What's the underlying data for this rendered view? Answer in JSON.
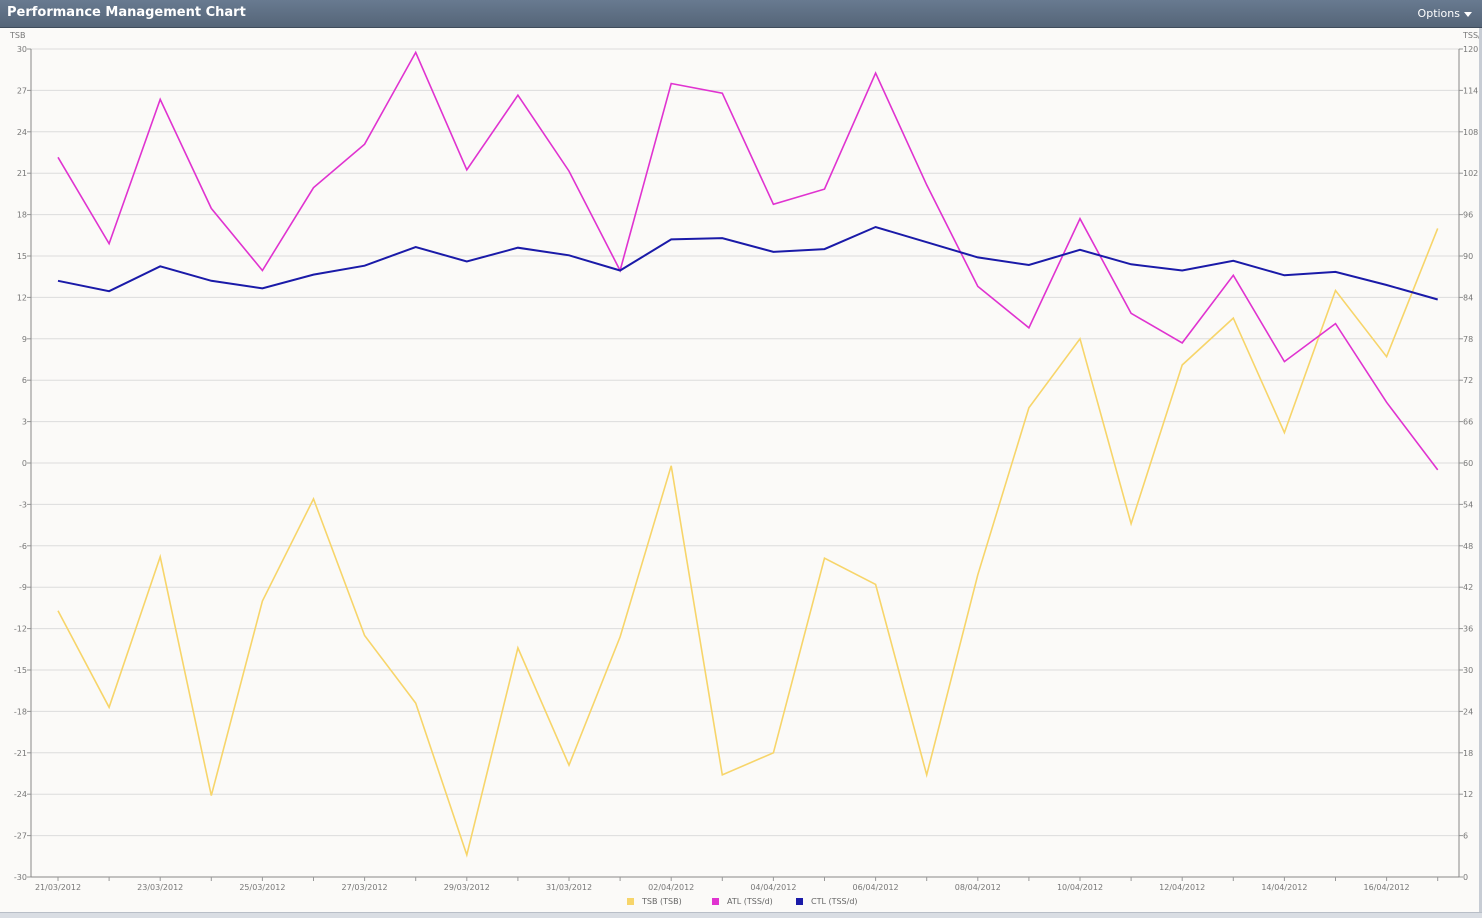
{
  "window": {
    "title": "Performance Management Chart",
    "options_label": "Options"
  },
  "chart_data": {
    "type": "line",
    "left_axis": {
      "label": "TSB",
      "min": -30,
      "max": 30,
      "ticks": [
        30,
        27,
        24,
        21,
        18,
        15,
        12,
        9,
        6,
        3,
        0,
        -3,
        -6,
        -9,
        -12,
        -15,
        -18,
        -21,
        -24,
        -27,
        -30
      ]
    },
    "right_axis": {
      "label": "TSS/d",
      "min": 0,
      "max": 120,
      "ticks": [
        120,
        114,
        108,
        102,
        96,
        90,
        84,
        78,
        72,
        66,
        60,
        54,
        48,
        42,
        36,
        30,
        24,
        18,
        12,
        6,
        0
      ]
    },
    "x": [
      "21/03/2012",
      "22/03/2012",
      "23/03/2012",
      "24/03/2012",
      "25/03/2012",
      "26/03/2012",
      "27/03/2012",
      "28/03/2012",
      "29/03/2012",
      "30/03/2012",
      "31/03/2012",
      "01/04/2012",
      "02/04/2012",
      "03/04/2012",
      "04/04/2012",
      "05/04/2012",
      "06/04/2012",
      "07/04/2012",
      "08/04/2012",
      "09/04/2012",
      "10/04/2012",
      "11/04/2012",
      "12/04/2012",
      "13/04/2012",
      "14/04/2012",
      "15/04/2012",
      "16/04/2012",
      "17/04/2012"
    ],
    "x_tick_labels": [
      "21/03/2012",
      "23/03/2012",
      "25/03/2012",
      "27/03/2012",
      "29/03/2012",
      "31/03/2012",
      "02/04/2012",
      "04/04/2012",
      "06/04/2012",
      "08/04/2012",
      "10/04/2012",
      "12/04/2012",
      "14/04/2012",
      "16/04/2012"
    ],
    "grid": true,
    "legend_position": "bottom",
    "series": [
      {
        "name": "TSB (TSB)",
        "axis": "left",
        "color": "#f7d56a",
        "values": [
          -10.7,
          -17.7,
          -6.8,
          -24.1,
          -10.0,
          -2.6,
          -12.5,
          -17.4,
          -28.4,
          -13.4,
          -21.9,
          -12.6,
          -0.2,
          -22.6,
          -21.0,
          -6.9,
          -8.8,
          -22.6,
          -8.1,
          4.0,
          9.0,
          -4.4,
          7.1,
          10.5,
          2.2,
          12.5,
          7.7,
          17.0
        ]
      },
      {
        "name": "ATL (TSS/d)",
        "axis": "right",
        "color": "#e033d0",
        "values": [
          104.3,
          91.8,
          112.7,
          96.9,
          87.9,
          99.9,
          106.2,
          119.5,
          102.5,
          113.3,
          102.3,
          87.9,
          115.0,
          113.6,
          97.5,
          99.7,
          116.5,
          100.3,
          85.6,
          79.6,
          95.4,
          81.7,
          77.4,
          87.2,
          74.7,
          80.2,
          68.8,
          59.0
        ]
      },
      {
        "name": "CTL (TSS/d)",
        "axis": "right",
        "color": "#1a1aa8",
        "values": [
          86.4,
          84.9,
          88.5,
          86.4,
          85.3,
          87.3,
          88.6,
          91.3,
          89.2,
          91.2,
          90.1,
          87.9,
          92.4,
          92.6,
          90.6,
          91.0,
          94.2,
          92.0,
          89.8,
          88.7,
          90.9,
          88.8,
          87.9,
          89.3,
          87.2,
          87.7,
          85.8,
          83.7
        ]
      }
    ]
  },
  "legend": {
    "items": [
      {
        "label": "TSB (TSB)",
        "color": "#f7d56a"
      },
      {
        "label": "ATL (TSS/d)",
        "color": "#e033d0"
      },
      {
        "label": "CTL (TSS/d)",
        "color": "#1a1aa8"
      }
    ]
  }
}
